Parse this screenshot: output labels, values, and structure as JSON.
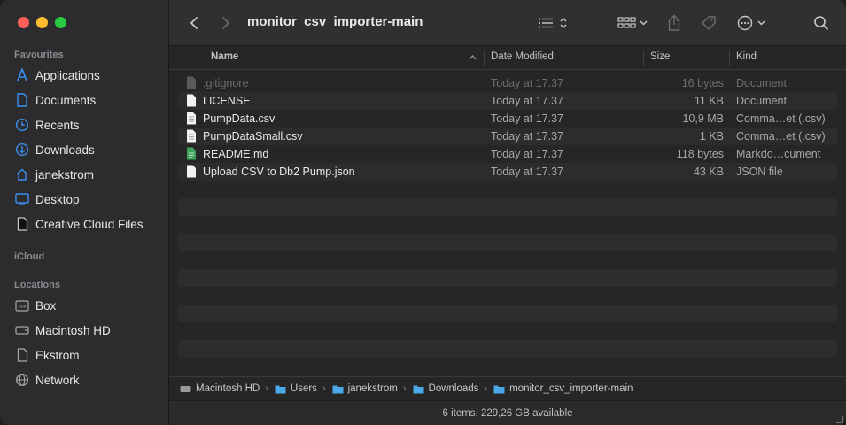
{
  "window": {
    "title": "monitor_csv_importer-main"
  },
  "sidebar": {
    "favourites_title": "Favourites",
    "icloud_title": "iCloud",
    "locations_title": "Locations",
    "favourites": [
      {
        "label": "Applications",
        "icon": "applications-icon"
      },
      {
        "label": "Documents",
        "icon": "document-icon"
      },
      {
        "label": "Recents",
        "icon": "clock-icon"
      },
      {
        "label": "Downloads",
        "icon": "download-icon"
      },
      {
        "label": "janekstrom",
        "icon": "home-icon"
      },
      {
        "label": "Desktop",
        "icon": "desktop-icon"
      },
      {
        "label": "Creative Cloud Files",
        "icon": "file-icon"
      }
    ],
    "locations": [
      {
        "label": "Box",
        "icon": "box-drive-icon"
      },
      {
        "label": "Macintosh HD",
        "icon": "hard-drive-icon"
      },
      {
        "label": "Ekstrom",
        "icon": "file-icon"
      },
      {
        "label": "Network",
        "icon": "network-icon"
      }
    ]
  },
  "columns": {
    "name": "Name",
    "date": "Date Modified",
    "size": "Size",
    "kind": "Kind"
  },
  "files": [
    {
      "name": ".gitignore",
      "date": "Today at 17.37",
      "size": "16 bytes",
      "kind": "Document",
      "dim": true
    },
    {
      "name": "LICENSE",
      "date": "Today at 17.37",
      "size": "11 KB",
      "kind": "Document",
      "dim": false
    },
    {
      "name": "PumpData.csv",
      "date": "Today at 17.37",
      "size": "10,9 MB",
      "kind": "Comma…et (.csv)",
      "dim": false
    },
    {
      "name": "PumpDataSmall.csv",
      "date": "Today at 17.37",
      "size": "1 KB",
      "kind": "Comma…et (.csv)",
      "dim": false
    },
    {
      "name": "README.md",
      "date": "Today at 17.37",
      "size": "118 bytes",
      "kind": "Markdo…cument",
      "dim": false
    },
    {
      "name": "Upload CSV to Db2 Pump.json",
      "date": "Today at 17.37",
      "size": "43 KB",
      "kind": "JSON file",
      "dim": false
    }
  ],
  "path": [
    "Macintosh HD",
    "Users",
    "janekstrom",
    "Downloads",
    "monitor_csv_importer-main"
  ],
  "status": {
    "text": "6 items, 229,26 GB available"
  },
  "colors": {
    "accent": "#3b82f6",
    "folder": "#4aa8e8"
  }
}
